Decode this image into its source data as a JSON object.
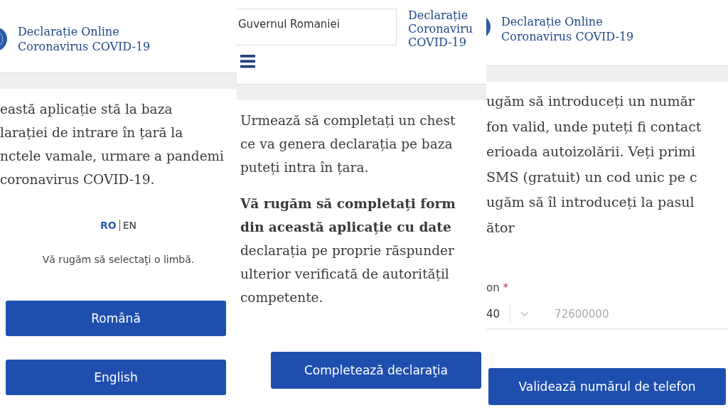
{
  "panels": [
    {
      "kind": "language",
      "title_lines": [
        "Declarație Online",
        "Coronavirus COVID-19"
      ],
      "paragraphs": [
        [
          {
            "text": "eastă aplicație stă la baza",
            "bold": false
          },
          {
            "text": "larației de intrare în țară la",
            "bold": false
          },
          {
            "text": "nctele vamale, urmare a pandemi",
            "bold": false
          },
          {
            "text": "coronavirus COVID-19.",
            "bold": false
          }
        ]
      ],
      "languages": [
        {
          "label": "RO",
          "selected": true
        },
        {
          "label": "EN",
          "selected": false
        }
      ],
      "prompt": "Vă rugăm să selectaţi o limbă.",
      "buttons": [
        "Română",
        "English"
      ]
    },
    {
      "kind": "intro",
      "search_value": "Guvernul Romaniei",
      "title_lines": [
        "Declarație",
        "Coronaviru",
        "COVID-19"
      ],
      "paragraphs": [
        [
          {
            "text": "Urmează să completați un chest",
            "bold": false
          },
          {
            "text": "ce va genera declarația pe baza",
            "bold": false
          },
          {
            "text": "puteți intra în țara.",
            "bold": false
          }
        ],
        [
          {
            "text": "Vă rugăm să completați form",
            "bold": true
          },
          {
            "text": "din această aplicație cu date",
            "bold": true
          },
          {
            "text": "declarația pe proprie răspunder",
            "bold": false
          },
          {
            "text": "ulterior verificată de autoritățil",
            "bold": false
          },
          {
            "text": "competente.",
            "bold": false
          }
        ]
      ],
      "buttons": [
        "Completează declaraţia"
      ]
    },
    {
      "kind": "phone",
      "title_lines": [
        "Declarație Online",
        "Coronavirus COVID-19"
      ],
      "paragraphs": [
        [
          {
            "text": "ugăm să introduceți un număr",
            "bold": false
          },
          {
            "text": "fon valid, unde puteți fi contact",
            "bold": false
          },
          {
            "text": "erioada autoizolării. Veți primi",
            "bold": false
          },
          {
            "text": "SMS (gratuit) un cod unic pe c",
            "bold": false
          },
          {
            "text": "ugăm să îl introduceți la pasul",
            "bold": false
          },
          {
            "text": "ător",
            "bold": false
          }
        ]
      ],
      "field_label": "on",
      "required_mark": "*",
      "prefix": "40",
      "placeholder": "72600000",
      "buttons": [
        "Validează numărul de telefon"
      ]
    }
  ]
}
